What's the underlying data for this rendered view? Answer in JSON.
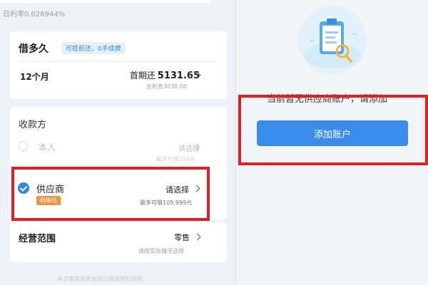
{
  "daily_rate": "日利率0.026944%",
  "borrow": {
    "title": "借多久",
    "badge": "可提前还，0手续费",
    "term": "12个月",
    "first_repay_label": "首期还",
    "first_repay_amount": "5131.65",
    "total_interest": "总利息3038.00"
  },
  "payee": {
    "title": "收款方",
    "self_label": "本人",
    "self_select": "请选择",
    "self_limit": "最多可借199元",
    "supplier_label": "供应商",
    "supplier_tag": "利率低",
    "supplier_select": "请选择",
    "supplier_limit": "最多可借109,999元"
  },
  "scope": {
    "title": "经营范围",
    "value": "零售",
    "hint": "请按实际情况选择"
  },
  "footer_note": "本次借款服务由浙江网商银行提供",
  "right": {
    "empty_text": "当前暂无供应商账户，请添加",
    "add_button": "添加账户"
  },
  "colors": {
    "accent": "#3b8beb",
    "highlight": "#dd1f27",
    "tag": "#f09440"
  }
}
